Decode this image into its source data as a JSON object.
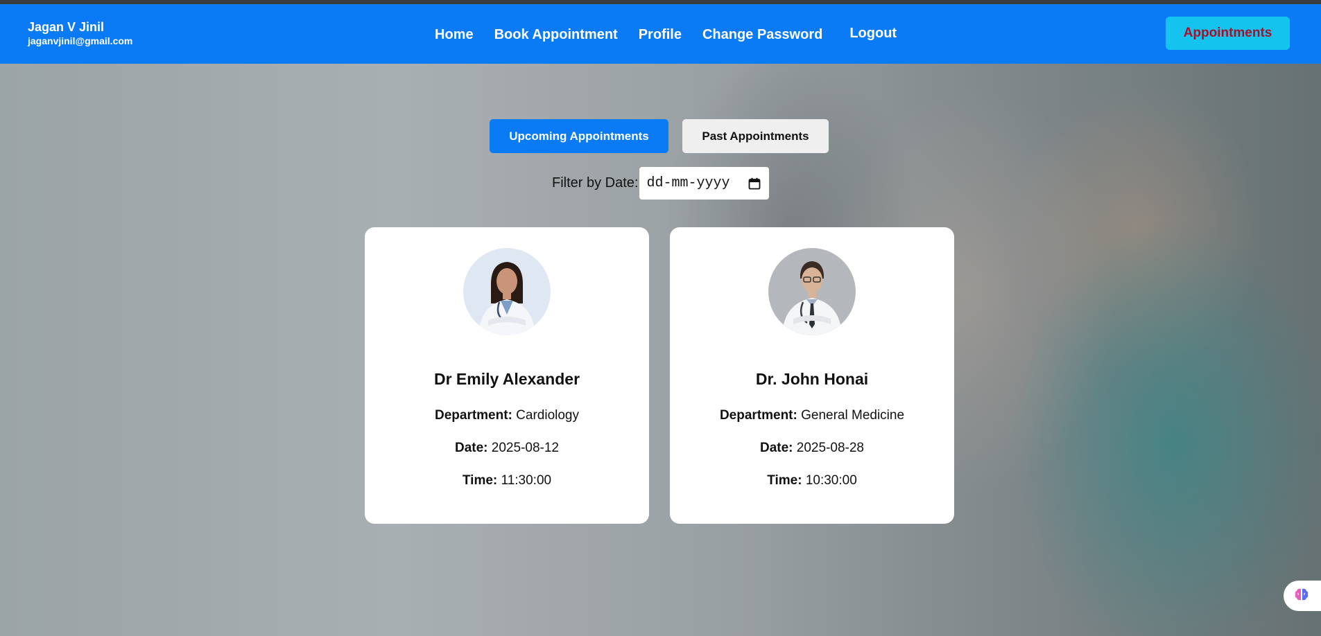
{
  "user": {
    "name": "Jagan V Jinil",
    "email": "jaganvjinil@gmail.com"
  },
  "nav": {
    "links": [
      "Home",
      "Book Appointment",
      "Profile",
      "Change Password",
      "Logout"
    ],
    "appointments_button": "Appointments"
  },
  "tabs": {
    "upcoming": "Upcoming Appointments",
    "past": "Past Appointments"
  },
  "filter": {
    "label": "Filter by Date:",
    "placeholder": "dd-mm-yyyy"
  },
  "labels": {
    "department": "Department:",
    "date": "Date:",
    "time": "Time:"
  },
  "appointments": [
    {
      "doctor": "Dr Emily Alexander",
      "department": "Cardiology",
      "date": "2025-08-12",
      "time": "11:30:00"
    },
    {
      "doctor": "Dr. John Honai",
      "department": "General Medicine",
      "date": "2025-08-28",
      "time": "10:30:00"
    }
  ],
  "colors": {
    "primary": "#0b7bf5",
    "accent_button": "#14c4ee",
    "accent_text": "#a8102a"
  }
}
